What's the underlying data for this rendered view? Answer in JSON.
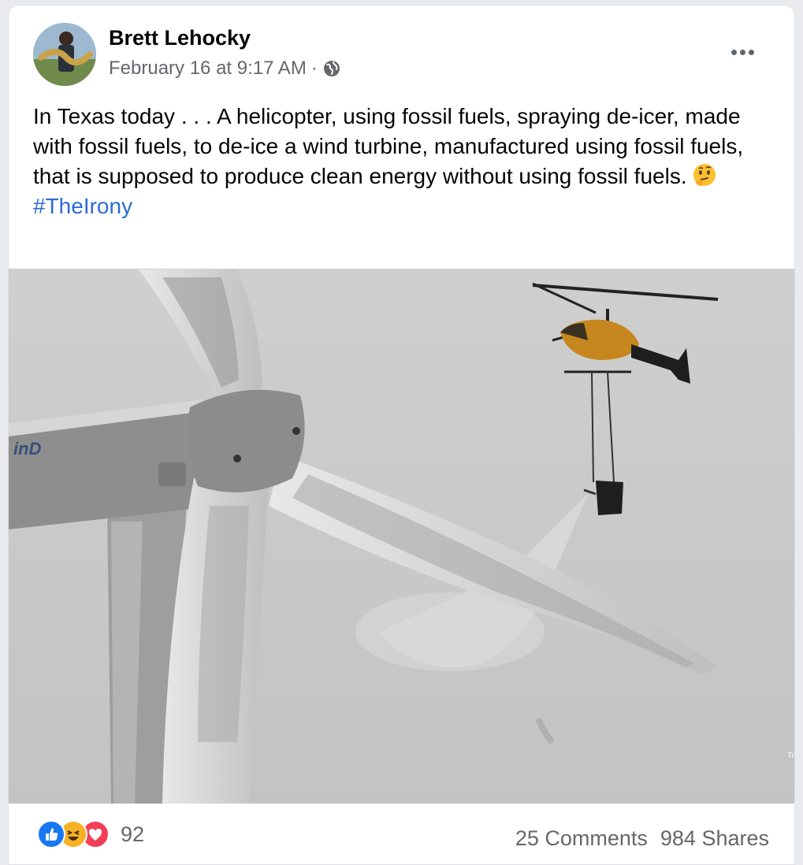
{
  "post": {
    "author": "Brett Lehocky",
    "timestamp": "February 16 at 9:17 AM",
    "separator": "·",
    "privacy_icon": "globe-icon",
    "text": "In Texas today . . . A helicopter, using fossil fuels, spraying de-icer, made with fossil fuels, to de-ice a wind turbine, manufactured using fossil fuels, that is supposed to produce clean energy without using fossil fuels.",
    "hashtag": "#TheIrony",
    "emoji": "thinking-face-icon"
  },
  "photo": {
    "turbine_text": "inD",
    "corner_text": "Tr"
  },
  "footer": {
    "reaction_icons": [
      "like-icon",
      "haha-icon",
      "love-icon"
    ],
    "reaction_count": "92",
    "comments": "25 Comments",
    "shares": "984 Shares"
  },
  "colors": {
    "link": "#2d6bd6",
    "meta": "#65676b",
    "like": "#1877f2",
    "haha": "#f7b125",
    "love": "#f33e58"
  }
}
